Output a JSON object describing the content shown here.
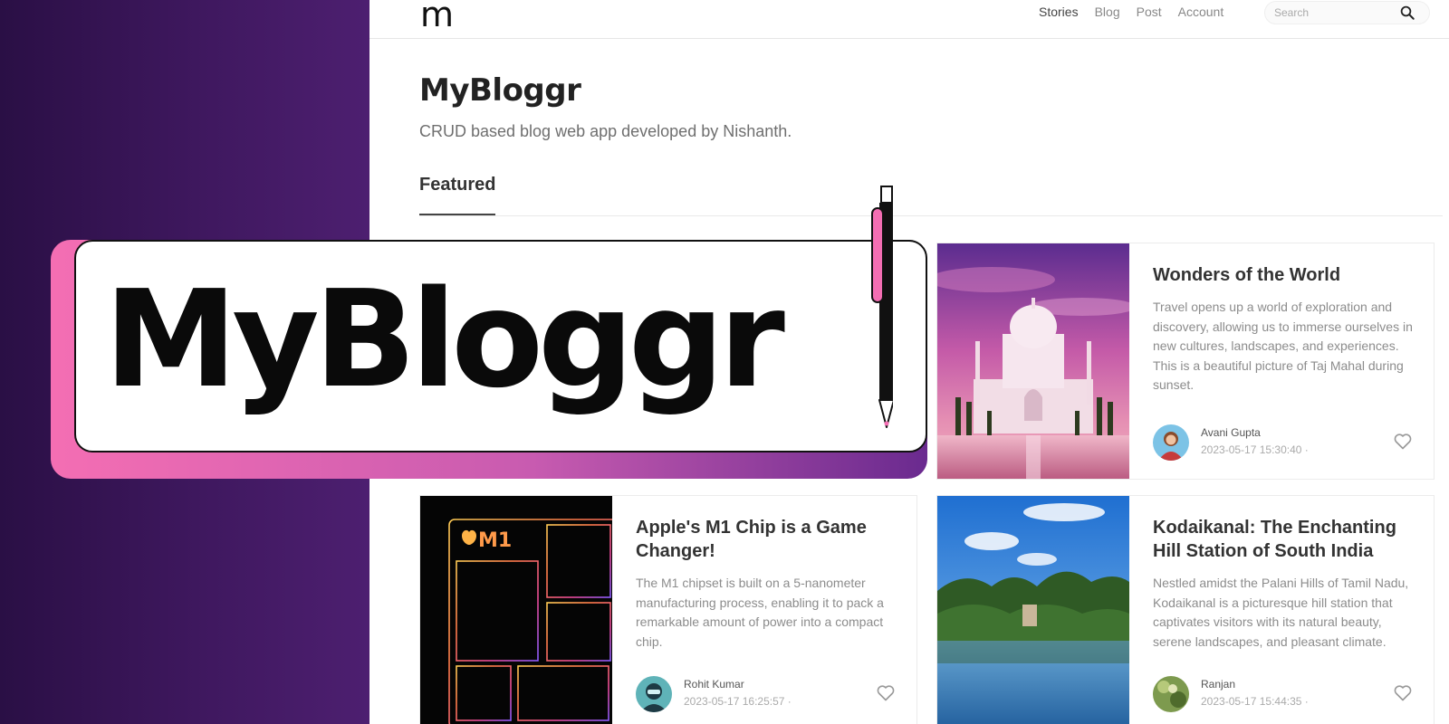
{
  "brand": {
    "logo_letter": "m",
    "banner_title": "MyBloggr"
  },
  "nav": {
    "links": [
      {
        "label": "Stories",
        "active": true
      },
      {
        "label": "Blog",
        "active": false
      },
      {
        "label": "Post",
        "active": false
      },
      {
        "label": "Account",
        "active": false
      }
    ],
    "search_placeholder": "Search"
  },
  "header": {
    "title": "MyBloggr",
    "subtitle": "CRUD based blog web app developed by Nishanth.",
    "tab": "Featured"
  },
  "posts": [
    {
      "title": "Wonders of the World",
      "excerpt": "Travel opens up a world of exploration and discovery, allowing us to immerse ourselves in new cultures, landscapes, and experiences. This is a beautiful picture of Taj Mahal during sunset.",
      "author": "Avani Gupta",
      "date": "2023-05-17 15:30:40 ·"
    },
    {
      "title": "Apple's M1 Chip is a Game Changer!",
      "excerpt": "The M1 chipset is built on a 5-nanometer manufacturing process, enabling it to pack a remarkable amount of power into a compact chip.",
      "author": "Rohit Kumar",
      "date": "2023-05-17 16:25:57 ·",
      "image_label": "M1"
    },
    {
      "title": "Kodaikanal: The Enchanting Hill Station of South India",
      "excerpt": "Nestled amidst the Palani Hills of Tamil Nadu, Kodaikanal is a picturesque hill station that captivates visitors with its natural beauty, serene landscapes, and pleasant climate.",
      "author": "Ranjan",
      "date": "2023-05-17 15:44:35 ·"
    }
  ],
  "colors": {
    "left_panel": "#3f185f",
    "banner_pink": "#f46eb3",
    "banner_purple": "#6a2a8f",
    "pen_pink": "#f46eb3"
  }
}
